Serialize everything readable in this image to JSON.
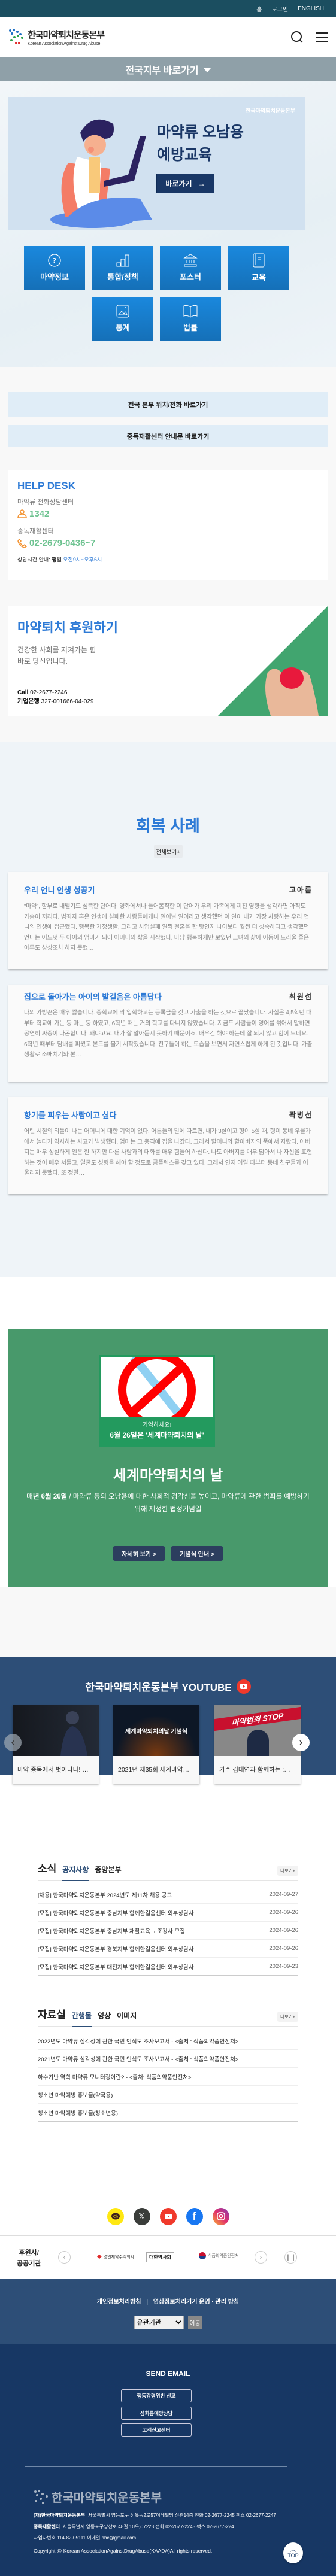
{
  "topbar": {
    "home": "홈",
    "login": "로그인",
    "english": "ENGLISH"
  },
  "header": {
    "logo_ko": "한국마약퇴치운동본부",
    "logo_en": "Korean Association Against Drug Abuse"
  },
  "branch_bar": {
    "label": "전국지부 바로가기"
  },
  "hero": {
    "watermark": "한국마약퇴치운동본부",
    "title_line1": "마약류 오남용",
    "title_line2": "예방교육",
    "button": "바로가기"
  },
  "tiles": [
    {
      "label": "마약정보",
      "icon": "question-circle-icon"
    },
    {
      "label": "통합/정책",
      "icon": "bar-chart-icon"
    },
    {
      "label": "포스터",
      "icon": "institution-icon"
    },
    {
      "label": "교육",
      "icon": "book-icon"
    },
    {
      "label": "통계",
      "icon": "image-icon"
    },
    {
      "label": "법률",
      "icon": "open-book-icon"
    }
  ],
  "quick_links": [
    "전국 본부 위치/전화 바로가기",
    "중독재활센터 안내문 바로가기"
  ],
  "helpdesk": {
    "title": "HELP DESK",
    "line1_label": "마약류 전화상담센터",
    "line1_number": "1342",
    "line2_label": "중독재활센터",
    "line2_number": "02-2679-0436~7",
    "hours_label": "상담시간 안내:",
    "hours_day": "평일",
    "hours_time": "오전9시~오후6시"
  },
  "support": {
    "title": "마약퇴치 후원하기",
    "desc_line1": "건강한 사회를 지켜가는 힘",
    "desc_line2": "바로 당신입니다.",
    "call_label": "Call",
    "call_number": "02-2677-2246",
    "bank_label": "기업은행",
    "bank_account": "327-001666-04-029"
  },
  "recovery": {
    "title": "회복 사례",
    "view_all": "전체보기+",
    "stories": [
      {
        "title": "우리 언니 인생 성공기",
        "author": "고아름",
        "excerpt": "“마약”, 함부로 내뱉기도 섬뜩한 단어다. 영화에서나 들어봄직한 이 단어가 우리 가족에게 끼친 영향을 생각하면 아직도 가슴이 저리다. 범죄자 혹은 인생에 실패한 사람들에게나 일어날 일이라고 생각했던 이 일이 내가 가장 사랑하는 우리 언니의 인생에 접근했다. 행복한 가정생활, 그리고 사업실패 일찍 결혼을 한 탓인지 나이보다 훨씬 더 성숙하다고 생각했던 언니는 어느덧 두 아이의 엄마가 되어 어머니의 삶을 시작했다. 마냥 행복하게만 보였던 그녀의 삶에 어둠이 드리울 줄은 아무도 상상조차 하지 못했…"
      },
      {
        "title": "집으로 돌아가는 아이의 발걸음은 아름답다",
        "author": "최원섭",
        "excerpt": "나의 가방끈은 매우 짧습니다. 중학교에 막 입학하고는 등록금을 갖고 가출을 하는 것으로 끝났습니다. 사실은 4,5학년 때부터 학교에 가는 둥 마는 둥 하였고, 6학년 때는 거의 학교를 다니지 않았습니다. 지금도 사람들이 영어를 섞어서 말하면 공연히 짜증이 나곤합니다. 왜냐고요. 내가 잘 알아듣지 못하기 때문이죠. 배우긴 해야 하는데 잘 되지 않고 힘이 드네요. 6학년 때부터 담배를 피웠고 본드를 불기 시작했습니다. 친구들이 하는 모습을 보면서 자연스럽게 하게 된 것입니다. 가출생활로 소매치기와 본…"
      },
      {
        "title": "향기를 피우는 사람이고 싶다",
        "author": "곽병선",
        "excerpt": "어린 시절의 외톨이 나는 어머니에 대한 기억이 없다. 어른들의 말에 따르면, 내가 3살이고 형이 5살 때, 형이 동네 우물가에서 놀다가 익사하는 사고가 발생했다. 엄마는 그 충격에 집을 나갔다. 그래서 할머니와 할아버지의 품에서 자랐다. 아버지는 매우 성실하게 일은 잘 하지만 다른 사람과의 대화를 매우 힘들어 하신다. 나도 아버지를 매우 닮아서 나 자신을 표현하는 것이 매우 서툴고, 얼굴도 성형을 해야 할 정도로 콤플렉스를 갖고 있다. 그래서 인지 어릴 때부터 동네 친구들과 어울리지 못했다. 또 정말…"
      }
    ]
  },
  "world_day": {
    "poster_line1": "기억하세요!",
    "poster_line2": "6월 26일은 '세계마약퇴치의 날'",
    "title": "세계마약퇴치의 날",
    "desc_bold": "매년 6월 26일",
    "desc": " / 마약류 등의 오남용에 대한 사회적 경각심을 높이고, 마약류에 관한 범죄를 예방하기 위해 제정한 법정기념일",
    "btn_detail": "자세히 보기 >",
    "btn_ceremony": "기념식 안내 >"
  },
  "youtube": {
    "title": "한국마약퇴치운동본부 YOUTUBE",
    "videos": [
      {
        "caption": "마약 중독에서 벗어나다! …",
        "thumb_text": ""
      },
      {
        "caption": "2021년 제35회 세계마약…",
        "thumb_text": "세계마약퇴치의날 기념식"
      },
      {
        "caption": "가수 김태연과 함께하는 :…",
        "thumb_text": "마약범죄 STOP"
      }
    ]
  },
  "news": {
    "heading": "소식",
    "tabs": [
      "공지사항",
      "중앙본부"
    ],
    "active_tab": 0,
    "more": "더보기+",
    "rows": [
      {
        "title": "[채용] 한국마약퇴치운동본부 2024년도 제11차 채용 공고",
        "date": "2024-09-27"
      },
      {
        "title": "[모집] 한국마약퇴치운동본부 충남지부 함께한걸음센터 외부상담사 …",
        "date": "2024-09-26"
      },
      {
        "title": "[모집] 한국마약퇴치운동본부 충남지부 재활교육 보조강사 모집",
        "date": "2024-09-26"
      },
      {
        "title": "[모집] 한국마약퇴치운동본부 경북지부 함께한걸음센터 외부상담사 …",
        "date": "2024-09-26"
      },
      {
        "title": "[모집] 한국마약퇴치운동본부 대전지부 함께한걸음센터 외부상담사 …",
        "date": "2024-09-23"
      }
    ]
  },
  "library": {
    "heading": "자료실",
    "tabs": [
      "간행물",
      "영상",
      "이미지"
    ],
    "active_tab": 0,
    "more": "더보기+",
    "rows": [
      {
        "title": "2022년도 마약류 심각성에 관한 국민 인식도 조사보고서 - <출처 : 식품의약품안전처>"
      },
      {
        "title": "2021년도 마약류 심각성에 관한 국민 인식도 조사보고서 - <출처 : 식품의약품안전처>"
      },
      {
        "title": "하수기반 역학 마약류 모니터링이란? - <출처: 식품의약품안전처>"
      },
      {
        "title": "청소년 마약예방 홍보물(약국용)"
      },
      {
        "title": "청소년 마약예방 홍보물(청소년용)"
      }
    ]
  },
  "social": [
    "kakao-channel-icon",
    "x-icon",
    "youtube-icon",
    "facebook-icon",
    "instagram-icon"
  ],
  "sponsors": {
    "label_line1": "후원사/",
    "label_line2": "공공기관",
    "logos": [
      "명인제약주식회사",
      "대한약사회",
      "식품의약품안전처"
    ]
  },
  "footer": {
    "privacy": "개인정보처리방침",
    "cctv": "영상정보처리기기 운영 · 관리 방침",
    "select_value": "유관기관",
    "go": "이동",
    "send_email": "SEND EMAIL",
    "email_buttons": [
      "행동강령위반 신고",
      "성희롱예방상담",
      "고객신고센터"
    ],
    "logo": "한국마약퇴치운동본부",
    "hq_name": "(재)한국마약퇴치운동본부",
    "hq_info": "서울특별시 영등포구 선유동2로57이레빌딩 신관14층  전화 02-2677-2245 팩스 02-2677-2247",
    "center_name": "중독재활센터",
    "center_info": "서울특별시 영등포구당산로 48길 10우)07223  전화 02-2677-2245 팩스 02-2677-224",
    "biz": "사업자번호 114-82-05111  이메일 abc@gmail.com",
    "copyright": "Copyright @ Korean AssociationAgainstDrugAbuse(KAADA)All rights reserved.",
    "top": "TOP"
  }
}
